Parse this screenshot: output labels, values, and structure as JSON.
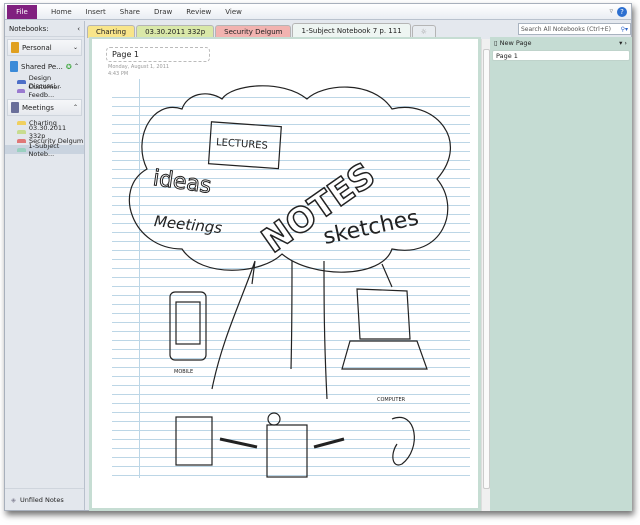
{
  "ribbon": {
    "file": "File",
    "tabs": [
      "Home",
      "Insert",
      "Share",
      "Draw",
      "Review",
      "View"
    ]
  },
  "nav": {
    "header": "Notebooks:",
    "collapse": "‹",
    "notebooks": [
      {
        "name": "Personal",
        "color": "#e0a020"
      },
      {
        "name": "Shared Pe...",
        "color": "#3a8ad8"
      },
      {
        "name": "Meetings",
        "color": "#6a6f9a"
      }
    ],
    "shared_sections": [
      {
        "name": "Design Discussi...",
        "color": "#4d6fc7"
      },
      {
        "name": "Customer Feedb...",
        "color": "#9a7ad0"
      }
    ],
    "meeting_sections": [
      {
        "name": "Charting",
        "color": "#f0d060"
      },
      {
        "name": "03.30.2011 332p",
        "color": "#c8dc90"
      },
      {
        "name": "Security Delgum",
        "color": "#e07878"
      },
      {
        "name": "1-Subject Noteb...",
        "color": "#9ad0c0"
      }
    ],
    "unfiled": "Unfiled Notes"
  },
  "section_tabs": [
    {
      "name": "Charting",
      "color": "#f8e58a"
    },
    {
      "name": "03.30.2011 332p",
      "color": "#d9e8a8"
    },
    {
      "name": "Security Delgum",
      "color": "#f2b3b0"
    },
    {
      "name": "1-Subject Notebook 7 p. 111",
      "color": "#eef5f2"
    }
  ],
  "search": {
    "placeholder": "Search All Notebooks (Ctrl+E)"
  },
  "page": {
    "title": "Page 1",
    "date": "Monday, August 1, 2011",
    "time": "4:43 PM"
  },
  "sketch": {
    "words": {
      "lectures": "LECTURES",
      "ideas": "ideas",
      "notes": "NOTES",
      "meetings": "Meetings",
      "sketches": "sketches",
      "mobile": "MOBILE",
      "computer": "COMPUTER"
    }
  },
  "pages_pane": {
    "new_page": "New Page",
    "pages": [
      "Page 1"
    ]
  }
}
